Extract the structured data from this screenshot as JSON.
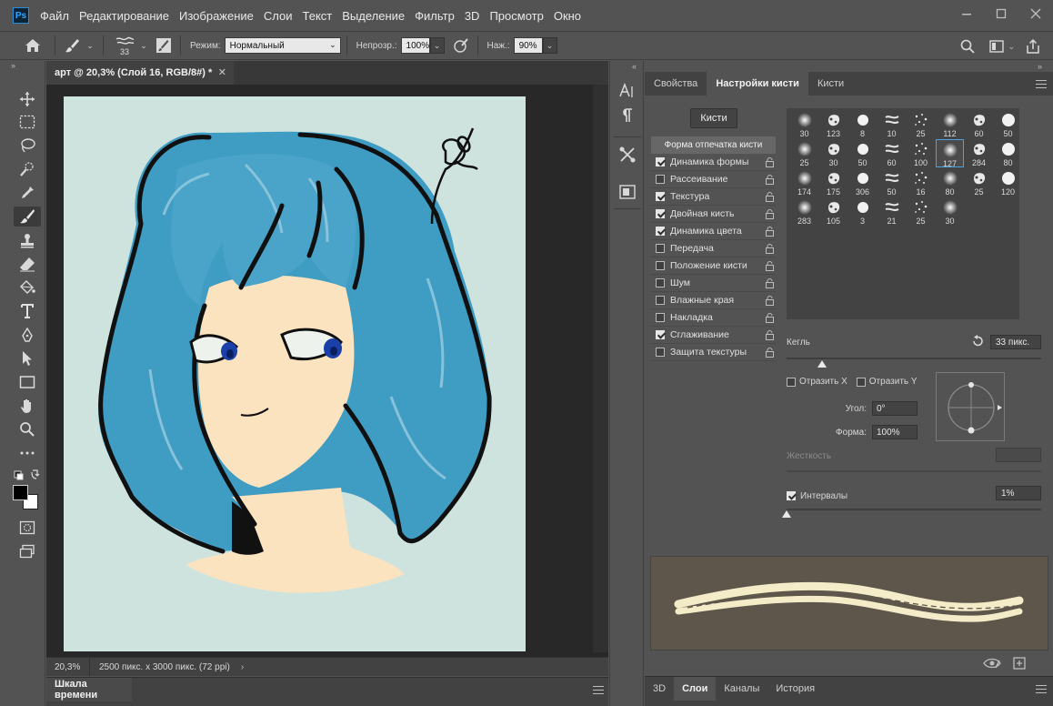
{
  "app": {
    "logo": "Ps"
  },
  "menu": [
    "Файл",
    "Редактирование",
    "Изображение",
    "Слои",
    "Текст",
    "Выделение",
    "Фильтр",
    "3D",
    "Просмотр",
    "Окно"
  ],
  "window_controls": [
    "minimize-icon",
    "maximize-icon",
    "close-icon"
  ],
  "options": {
    "brush_size": "33",
    "mode_label": "Режим:",
    "mode_value": "Нормальный",
    "opacity_label": "Непрозр.:",
    "opacity_value": "100%",
    "pressure_label": "Наж.:",
    "pressure_value": "90%"
  },
  "toolbar": {
    "tools": [
      "move-tool",
      "marquee-tool",
      "lasso-tool",
      "quick-select-tool",
      "eyedropper-tool",
      "brush-tool",
      "stamp-tool",
      "eraser-tool",
      "fill-tool",
      "type-tool",
      "pen-tool",
      "path-select-tool",
      "rectangle-tool",
      "hand-tool",
      "zoom-tool",
      "more-tools",
      "default-colors",
      "foreground-background",
      "quick-mask",
      "screen-mode"
    ],
    "active_tool": "brush-tool",
    "foreground_color": "#000000",
    "background_color": "#ffffff"
  },
  "document": {
    "tab_title": "арт @ 20,3% (Слой 16, RGB/8#) *",
    "zoom": "20,3%",
    "info": "2500 пикс. x 3000 пикс. (72 ppi)",
    "canvas_bg": "#cfe3de"
  },
  "timeline": {
    "tab": "Шкала времени"
  },
  "brush_panel": {
    "tabs": [
      "Свойства",
      "Настройки кисти",
      "Кисти"
    ],
    "active_tab": "Настройки кисти",
    "brushes_button": "Кисти",
    "tip_shape_header": "Форма отпечатка кисти",
    "properties": [
      {
        "label": "Динамика формы",
        "checked": true
      },
      {
        "label": "Рассеивание",
        "checked": false
      },
      {
        "label": "Текстура",
        "checked": true
      },
      {
        "label": "Двойная кисть",
        "checked": true
      },
      {
        "label": "Динамика цвета",
        "checked": true
      },
      {
        "label": "Передача",
        "checked": false
      },
      {
        "label": "Положение кисти",
        "checked": false
      },
      {
        "label": "Шум",
        "checked": false
      },
      {
        "label": "Влажные края",
        "checked": false
      },
      {
        "label": "Накладка",
        "checked": false
      },
      {
        "label": "Сглаживание",
        "checked": true
      },
      {
        "label": "Защита текстуры",
        "checked": false
      }
    ],
    "brush_tips": [
      [
        "30",
        "123",
        "8",
        "10",
        "25",
        "112",
        "60",
        "50"
      ],
      [
        "25",
        "30",
        "50",
        "60",
        "100",
        "127",
        "284",
        "80"
      ],
      [
        "174",
        "175",
        "306",
        "50",
        "16",
        "80",
        "25",
        "120"
      ],
      [
        "283",
        "105",
        "3",
        "21",
        "25",
        "30"
      ]
    ],
    "selected_tip": "127",
    "size_label": "Кегль",
    "size_value": "33 пикс.",
    "size_fraction": 0.14,
    "flip_x_label": "Отразить X",
    "flip_y_label": "Отразить Y",
    "angle_label": "Угол:",
    "angle_value": "0°",
    "roundness_label": "Форма:",
    "roundness_value": "100%",
    "hardness_label": "Жесткость",
    "spacing_label": "Интервалы",
    "spacing_checked": true,
    "spacing_value": "1%",
    "spacing_fraction": 0.0,
    "preview_bg": "#5e564a",
    "stroke_color": "#f4ecc8"
  },
  "bottom_tabs": [
    "3D",
    "Слои",
    "Каналы",
    "История"
  ],
  "bottom_active": "Слои"
}
